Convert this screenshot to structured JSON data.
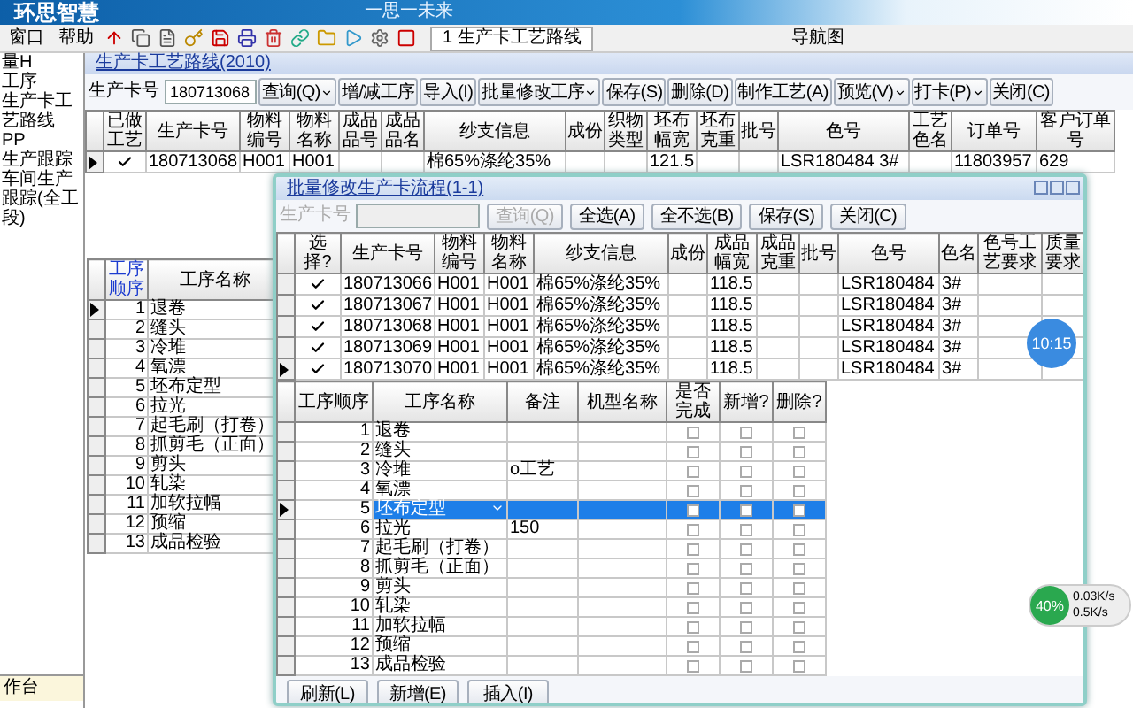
{
  "banner": {
    "logo": "环思智慧",
    "slogan": "一思一未来"
  },
  "menu": [
    "窗口",
    "帮助"
  ],
  "doc_tab": {
    "label": "1 生产卡工艺路线"
  },
  "nav_label": "导航图",
  "sidebar": {
    "items": [
      {
        "label": "量H"
      },
      {
        "label": "工序"
      },
      {
        "label": "生产卡工艺路线"
      },
      {
        "label": "PP"
      },
      {
        "label": "生产跟踪"
      },
      {
        "label": "车间生产跟踪(全工段)"
      }
    ],
    "tab": "作台"
  },
  "main": {
    "title": "生产卡工艺路线(2010)",
    "filter": {
      "label": "生产卡号",
      "value": "180713068"
    },
    "buttons": [
      {
        "label": "查询(Q)",
        "dropdown": true
      },
      {
        "label": "增/减工序",
        "dropdown": false
      },
      {
        "label": "导入(I)",
        "dropdown": false
      },
      {
        "label": "批量修改工序",
        "dropdown": true
      },
      {
        "label": "保存(S)",
        "dropdown": false
      },
      {
        "label": "删除(D)",
        "dropdown": false
      },
      {
        "label": "制作工艺(A)",
        "dropdown": false
      },
      {
        "label": "预览(V)",
        "dropdown": true
      },
      {
        "label": "打卡(P)",
        "dropdown": true
      },
      {
        "label": "关闭(C)",
        "dropdown": false
      }
    ],
    "grid": {
      "columns": [
        "已做工艺",
        "生产卡号",
        "物料编号",
        "物料名称",
        "成品品号",
        "成品品名",
        "纱支信息",
        "成份",
        "织物类型",
        "坯布幅宽",
        "坯布克重",
        "批号",
        "色号",
        "工艺色名",
        "订单号",
        "客户订单号"
      ],
      "rows": [
        {
          "current": true,
          "checked": true,
          "cells": [
            null,
            "180713068",
            "H001",
            "H001",
            null,
            null,
            "棉65%涤纶35%",
            null,
            null,
            "121.5",
            null,
            null,
            "LSR180484 3#",
            null,
            "11803957",
            "629"
          ]
        }
      ]
    }
  },
  "process_grid": {
    "columns": [
      "工序顺序",
      "工序名称"
    ],
    "rows": [
      {
        "order": "1",
        "name": "退卷",
        "current": true
      },
      {
        "order": "2",
        "name": "缝头",
        "current": false
      },
      {
        "order": "3",
        "name": "冷堆",
        "current": false
      },
      {
        "order": "4",
        "name": "氧漂",
        "current": false
      },
      {
        "order": "5",
        "name": "坯布定型",
        "current": false
      },
      {
        "order": "6",
        "name": "拉光",
        "current": false
      },
      {
        "order": "7",
        "name": "起毛刷（打卷）",
        "current": false
      },
      {
        "order": "8",
        "name": "抓剪毛（正面）",
        "current": false
      },
      {
        "order": "9",
        "name": "剪头",
        "current": false
      },
      {
        "order": "10",
        "name": "轧染",
        "current": false
      },
      {
        "order": "11",
        "name": "加软拉幅",
        "current": false
      },
      {
        "order": "12",
        "name": "预缩",
        "current": false
      },
      {
        "order": "13",
        "name": "成品检验",
        "current": false
      }
    ]
  },
  "dialog": {
    "title": "批量修改生产卡流程(1-1)",
    "filter": {
      "label": "生产卡号",
      "disabled": true
    },
    "buttons": [
      {
        "label": "查询(Q)",
        "disabled": true
      },
      {
        "label": "全选(A)",
        "disabled": false
      },
      {
        "label": "全不选(B)",
        "disabled": false
      },
      {
        "label": "保存(S)",
        "disabled": false
      },
      {
        "label": "关闭(C)",
        "disabled": false
      }
    ],
    "cards": {
      "columns": [
        "选择?",
        "生产卡号",
        "物料编号",
        "物料名称",
        "纱支信息",
        "成份",
        "成品幅宽",
        "成品克重",
        "批号",
        "色号",
        "色名",
        "色号工艺要求",
        "质量要求"
      ],
      "rows": [
        {
          "current": false,
          "checked": true,
          "cells": [
            null,
            "180713066",
            "H001",
            "H001",
            "棉65%涤纶35%",
            null,
            "118.5",
            null,
            null,
            "LSR180484",
            "3#",
            null,
            null
          ]
        },
        {
          "current": false,
          "checked": true,
          "cells": [
            null,
            "180713067",
            "H001",
            "H001",
            "棉65%涤纶35%",
            null,
            "118.5",
            null,
            null,
            "LSR180484",
            "3#",
            null,
            null
          ]
        },
        {
          "current": false,
          "checked": true,
          "cells": [
            null,
            "180713068",
            "H001",
            "H001",
            "棉65%涤纶35%",
            null,
            "118.5",
            null,
            null,
            "LSR180484",
            "3#",
            null,
            null
          ]
        },
        {
          "current": false,
          "checked": true,
          "cells": [
            null,
            "180713069",
            "H001",
            "H001",
            "棉65%涤纶35%",
            null,
            "118.5",
            null,
            null,
            "LSR180484",
            "3#",
            null,
            null
          ]
        },
        {
          "current": true,
          "checked": true,
          "cells": [
            null,
            "180713070",
            "H001",
            "H001",
            "棉65%涤纶35%",
            null,
            "118.5",
            null,
            null,
            "LSR180484",
            "3#",
            null,
            null
          ]
        }
      ]
    },
    "steps": {
      "columns": [
        "工序顺序",
        "工序名称",
        "备注",
        "机型名称",
        "是否完成",
        "新增?",
        "删除?"
      ],
      "rows": [
        {
          "order": "1",
          "name": "退卷",
          "done": false,
          "add": false,
          "del": false,
          "selected": false
        },
        {
          "order": "2",
          "name": "缝头",
          "done": false,
          "add": false,
          "del": false,
          "selected": false
        },
        {
          "order": "3",
          "name": "冷堆",
          "note": "o工艺",
          "done": false,
          "add": false,
          "del": false,
          "selected": false
        },
        {
          "order": "4",
          "name": "氧漂",
          "done": false,
          "add": false,
          "del": false,
          "selected": false
        },
        {
          "order": "5",
          "name": "坯布定型",
          "done": false,
          "add": false,
          "del": false,
          "selected": true
        },
        {
          "order": "6",
          "name": "拉光",
          "note": "150",
          "done": false,
          "add": false,
          "del": false,
          "selected": false
        },
        {
          "order": "7",
          "name": "起毛刷（打卷）",
          "done": false,
          "add": false,
          "del": false,
          "selected": false
        },
        {
          "order": "8",
          "name": "抓剪毛（正面）",
          "done": false,
          "add": false,
          "del": false,
          "selected": false
        },
        {
          "order": "9",
          "name": "剪头",
          "done": false,
          "add": false,
          "del": false,
          "selected": false
        },
        {
          "order": "10",
          "name": "轧染",
          "done": false,
          "add": false,
          "del": false,
          "selected": false
        },
        {
          "order": "11",
          "name": "加软拉幅",
          "done": false,
          "add": false,
          "del": false,
          "selected": false
        },
        {
          "order": "12",
          "name": "预缩",
          "done": false,
          "add": false,
          "del": false,
          "selected": false
        },
        {
          "order": "13",
          "name": "成品检验",
          "done": false,
          "add": false,
          "del": false,
          "selected": false
        }
      ]
    },
    "bottom_buttons": [
      "刷新(L)",
      "新增(E)",
      "插入(I)"
    ]
  },
  "timer": "10:15",
  "net": {
    "percent": "40%",
    "up": "0.03K/s",
    "down": "0.5K/s"
  }
}
